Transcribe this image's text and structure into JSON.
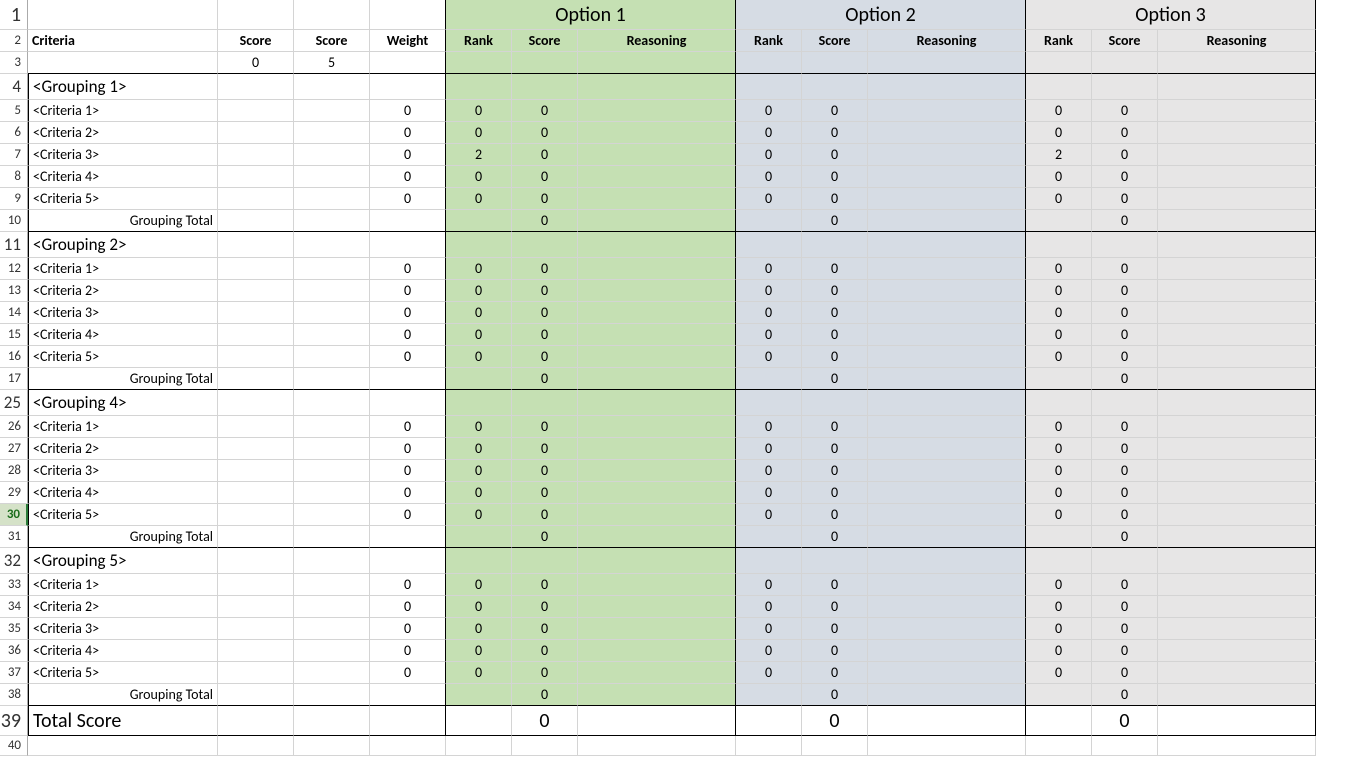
{
  "row_labels": [
    "1",
    "2",
    "3",
    "4",
    "5",
    "6",
    "7",
    "8",
    "9",
    "10",
    "11",
    "12",
    "13",
    "14",
    "15",
    "16",
    "17",
    "25",
    "26",
    "27",
    "28",
    "29",
    "30",
    "31",
    "32",
    "33",
    "34",
    "35",
    "36",
    "37",
    "38",
    "39",
    "40"
  ],
  "selected_row_index": 22,
  "hdr": {
    "criteria": "Criteria",
    "score1": "Score",
    "score2": "Score",
    "weight": "Weight",
    "rank": "Rank",
    "score": "Score",
    "reasoning": "Reasoning",
    "opt1": "Option 1",
    "opt2": "Option 2",
    "opt3": "Option 3"
  },
  "scale": {
    "low": "0",
    "high": "5"
  },
  "grouping_total": "Grouping Total",
  "total_score": "Total Score",
  "groups": [
    {
      "title": "<Grouping 1>",
      "rows": [
        {
          "name": "<Criteria 1>",
          "w": "0",
          "o1r": "0",
          "o1s": "0",
          "o2r": "0",
          "o2s": "0",
          "o3r": "0",
          "o3s": "0"
        },
        {
          "name": "<Criteria 2>",
          "w": "0",
          "o1r": "0",
          "o1s": "0",
          "o2r": "0",
          "o2s": "0",
          "o3r": "0",
          "o3s": "0"
        },
        {
          "name": "<Criteria 3>",
          "w": "0",
          "o1r": "2",
          "o1s": "0",
          "o2r": "0",
          "o2s": "0",
          "o3r": "2",
          "o3s": "0"
        },
        {
          "name": "<Criteria 4>",
          "w": "0",
          "o1r": "0",
          "o1s": "0",
          "o2r": "0",
          "o2s": "0",
          "o3r": "0",
          "o3s": "0"
        },
        {
          "name": "<Criteria 5>",
          "w": "0",
          "o1r": "0",
          "o1s": "0",
          "o2r": "0",
          "o2s": "0",
          "o3r": "0",
          "o3s": "0"
        }
      ],
      "total": {
        "o1": "0",
        "o2": "0",
        "o3": "0"
      }
    },
    {
      "title": "<Grouping 2>",
      "rows": [
        {
          "name": "<Criteria 1>",
          "w": "0",
          "o1r": "0",
          "o1s": "0",
          "o2r": "0",
          "o2s": "0",
          "o3r": "0",
          "o3s": "0"
        },
        {
          "name": "<Criteria 2>",
          "w": "0",
          "o1r": "0",
          "o1s": "0",
          "o2r": "0",
          "o2s": "0",
          "o3r": "0",
          "o3s": "0"
        },
        {
          "name": "<Criteria 3>",
          "w": "0",
          "o1r": "0",
          "o1s": "0",
          "o2r": "0",
          "o2s": "0",
          "o3r": "0",
          "o3s": "0"
        },
        {
          "name": "<Criteria 4>",
          "w": "0",
          "o1r": "0",
          "o1s": "0",
          "o2r": "0",
          "o2s": "0",
          "o3r": "0",
          "o3s": "0"
        },
        {
          "name": "<Criteria 5>",
          "w": "0",
          "o1r": "0",
          "o1s": "0",
          "o2r": "0",
          "o2s": "0",
          "o3r": "0",
          "o3s": "0"
        }
      ],
      "total": {
        "o1": "0",
        "o2": "0",
        "o3": "0"
      }
    },
    {
      "title": "<Grouping 4>",
      "rows": [
        {
          "name": "<Criteria 1>",
          "w": "0",
          "o1r": "0",
          "o1s": "0",
          "o2r": "0",
          "o2s": "0",
          "o3r": "0",
          "o3s": "0"
        },
        {
          "name": "<Criteria 2>",
          "w": "0",
          "o1r": "0",
          "o1s": "0",
          "o2r": "0",
          "o2s": "0",
          "o3r": "0",
          "o3s": "0"
        },
        {
          "name": "<Criteria 3>",
          "w": "0",
          "o1r": "0",
          "o1s": "0",
          "o2r": "0",
          "o2s": "0",
          "o3r": "0",
          "o3s": "0"
        },
        {
          "name": "<Criteria 4>",
          "w": "0",
          "o1r": "0",
          "o1s": "0",
          "o2r": "0",
          "o2s": "0",
          "o3r": "0",
          "o3s": "0"
        },
        {
          "name": "<Criteria 5>",
          "w": "0",
          "o1r": "0",
          "o1s": "0",
          "o2r": "0",
          "o2s": "0",
          "o3r": "0",
          "o3s": "0"
        }
      ],
      "total": {
        "o1": "0",
        "o2": "0",
        "o3": "0"
      }
    },
    {
      "title": "<Grouping 5>",
      "rows": [
        {
          "name": "<Criteria 1>",
          "w": "0",
          "o1r": "0",
          "o1s": "0",
          "o2r": "0",
          "o2s": "0",
          "o3r": "0",
          "o3s": "0"
        },
        {
          "name": "<Criteria 2>",
          "w": "0",
          "o1r": "0",
          "o1s": "0",
          "o2r": "0",
          "o2s": "0",
          "o3r": "0",
          "o3s": "0"
        },
        {
          "name": "<Criteria 3>",
          "w": "0",
          "o1r": "0",
          "o1s": "0",
          "o2r": "0",
          "o2s": "0",
          "o3r": "0",
          "o3s": "0"
        },
        {
          "name": "<Criteria 4>",
          "w": "0",
          "o1r": "0",
          "o1s": "0",
          "o2r": "0",
          "o2s": "0",
          "o3r": "0",
          "o3s": "0"
        },
        {
          "name": "<Criteria 5>",
          "w": "0",
          "o1r": "0",
          "o1s": "0",
          "o2r": "0",
          "o2s": "0",
          "o3r": "0",
          "o3s": "0"
        }
      ],
      "total": {
        "o1": "0",
        "o2": "0",
        "o3": "0"
      }
    }
  ],
  "grand": {
    "o1": "0",
    "o2": "0",
    "o3": "0"
  }
}
